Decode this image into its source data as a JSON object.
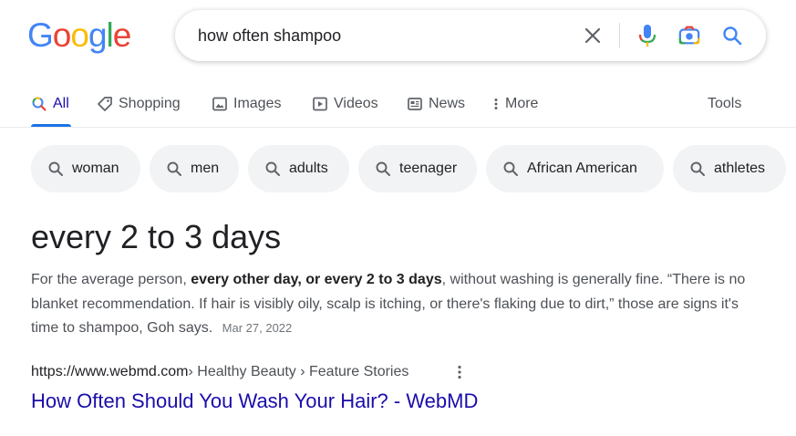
{
  "logo": {
    "letters": [
      "G",
      "o",
      "o",
      "g",
      "l",
      "e"
    ],
    "colors": [
      "#4285f4",
      "#ea4335",
      "#fbbc05",
      "#4285f4",
      "#34a853",
      "#ea4335"
    ]
  },
  "search": {
    "query": "how often shampoo",
    "clear_icon": "close-icon",
    "voice_icon": "microphone-icon",
    "lens_icon": "camera-icon",
    "submit_icon": "search-icon"
  },
  "tabs": {
    "all": "All",
    "shopping": "Shopping",
    "images": "Images",
    "videos": "Videos",
    "news": "News",
    "more": "More",
    "tools": "Tools"
  },
  "chips": [
    "woman",
    "men",
    "adults",
    "teenager",
    "African American",
    "athletes"
  ],
  "answer": {
    "title": "every 2 to 3 days",
    "snippet_pre": "For the average person, ",
    "snippet_bold": "every other day, or every 2 to 3 days",
    "snippet_post": ", without washing is generally fine. “There is no blanket recommendation. If hair is visibly oily, scalp is itching, or there's flaking due to dirt,” those are signs it's time to shampoo, Goh says.",
    "date": "Mar 27, 2022"
  },
  "result": {
    "url": "https://www.webmd.com",
    "breadcrumb": " › Healthy Beauty › Feature Stories",
    "title": "How Often Should You Wash Your Hair? - WebMD"
  },
  "colors": {
    "link": "#1a0dab",
    "active_tab": "#1a73e8",
    "chip_bg": "#f1f3f4"
  }
}
